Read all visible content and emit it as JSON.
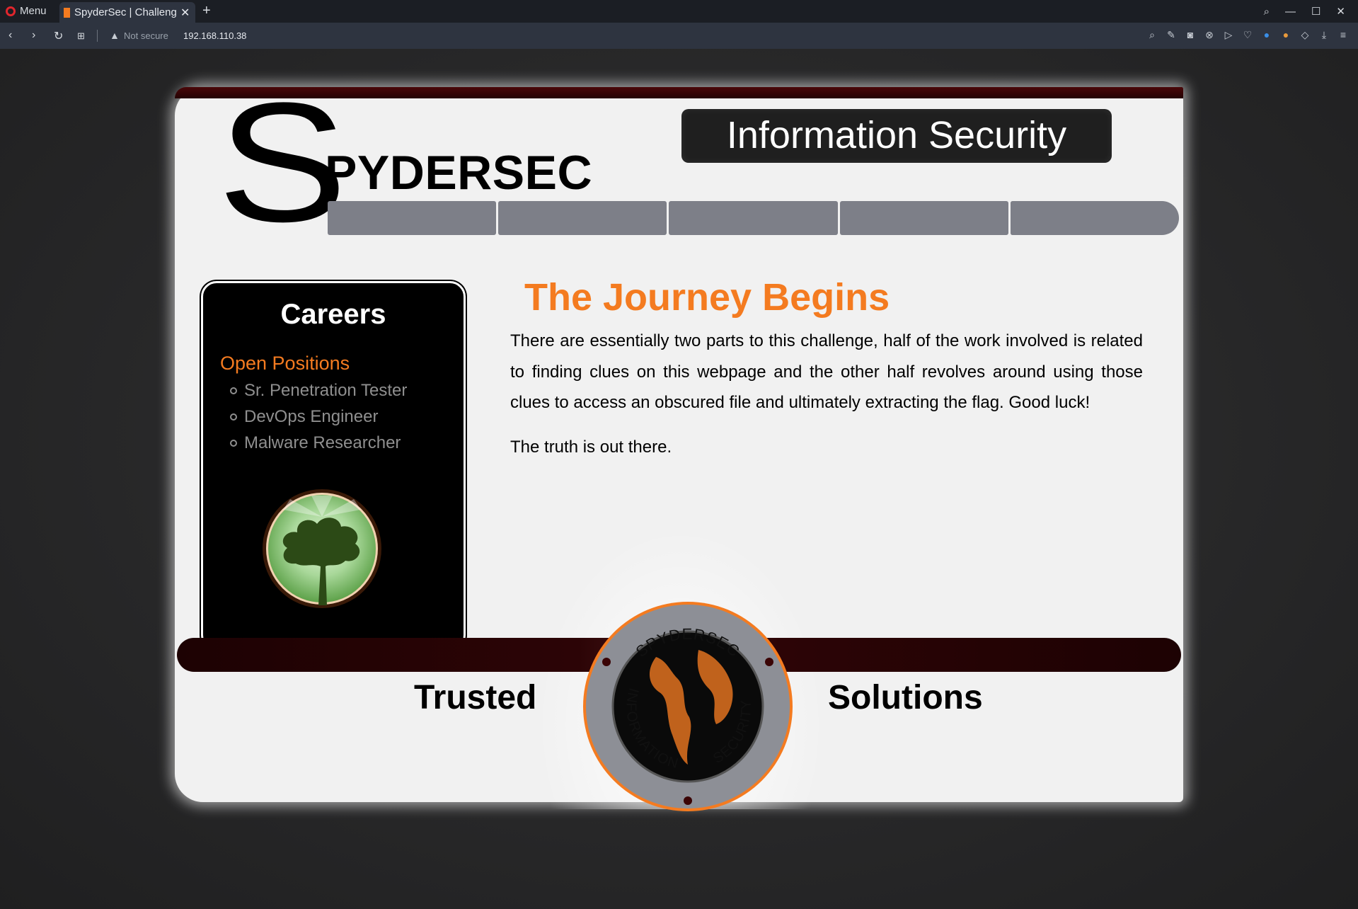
{
  "browser": {
    "menu_label": "Menu",
    "tab_title": "SpyderSec | Challenge",
    "security_label": "Not secure",
    "url": "192.168.110.38"
  },
  "page": {
    "brand_initial": "S",
    "brand_rest": "PYDERSEC",
    "tagline": "Information Security",
    "nav_items": [
      "",
      "",
      "",
      "",
      ""
    ],
    "careers": {
      "title": "Careers",
      "subtitle": "Open Positions",
      "positions": [
        "Sr. Penetration Tester",
        "DevOps Engineer",
        "Malware Researcher"
      ]
    },
    "content": {
      "title": "The Journey Begins",
      "paragraphs": [
        "There are essentially two parts to this challenge, half of the work involved is related to finding clues on this webpage and the other half revolves around using those clues to access an obscured file and ultimately extracting the flag. Good luck!",
        "The truth is out there."
      ]
    },
    "footer": {
      "left_word": "Trusted",
      "right_word": "Solutions",
      "seal_top": "SPYDERSEC",
      "seal_left": "INFORMATION",
      "seal_right": "SECURITY"
    }
  },
  "colors": {
    "accent_orange": "#f47b20",
    "nav_gray": "#7d7f88",
    "dark_red": "#2c0406"
  }
}
